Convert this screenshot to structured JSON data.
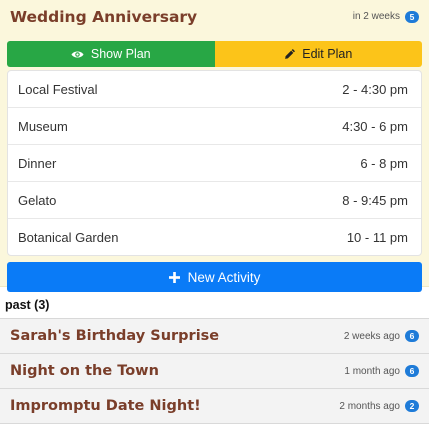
{
  "current": {
    "title": "Wedding Anniversary",
    "time": "in 2 weeks",
    "badge": "5",
    "show_label": "Show Plan",
    "edit_label": "Edit Plan",
    "activities": [
      {
        "name": "Local Festival",
        "time": "2 - 4:30 pm"
      },
      {
        "name": "Museum",
        "time": "4:30 - 6 pm"
      },
      {
        "name": "Dinner",
        "time": "6 - 8 pm"
      },
      {
        "name": "Gelato",
        "time": "8 - 9:45 pm"
      },
      {
        "name": "Botanical Garden",
        "time": "10 - 11 pm"
      }
    ],
    "new_activity_label": "New Activity"
  },
  "past": {
    "header": "past (3)",
    "items": [
      {
        "title": "Sarah's Birthday Surprise",
        "time": "2 weeks ago",
        "badge": "6"
      },
      {
        "title": "Night on the Town",
        "time": "1 month ago",
        "badge": "6"
      },
      {
        "title": "Impromptu Date Night!",
        "time": "2 months ago",
        "badge": "2"
      }
    ]
  },
  "colors": {
    "card_bg": "#fbf7dc",
    "title": "#7a3e2a",
    "show_button": "#28a745",
    "edit_button": "#fcc419",
    "new_button": "#0a7bf7",
    "badge": "#1e7bd8"
  },
  "icons": {
    "show": "eye-icon",
    "edit": "pencil-icon",
    "new": "plus-icon"
  }
}
